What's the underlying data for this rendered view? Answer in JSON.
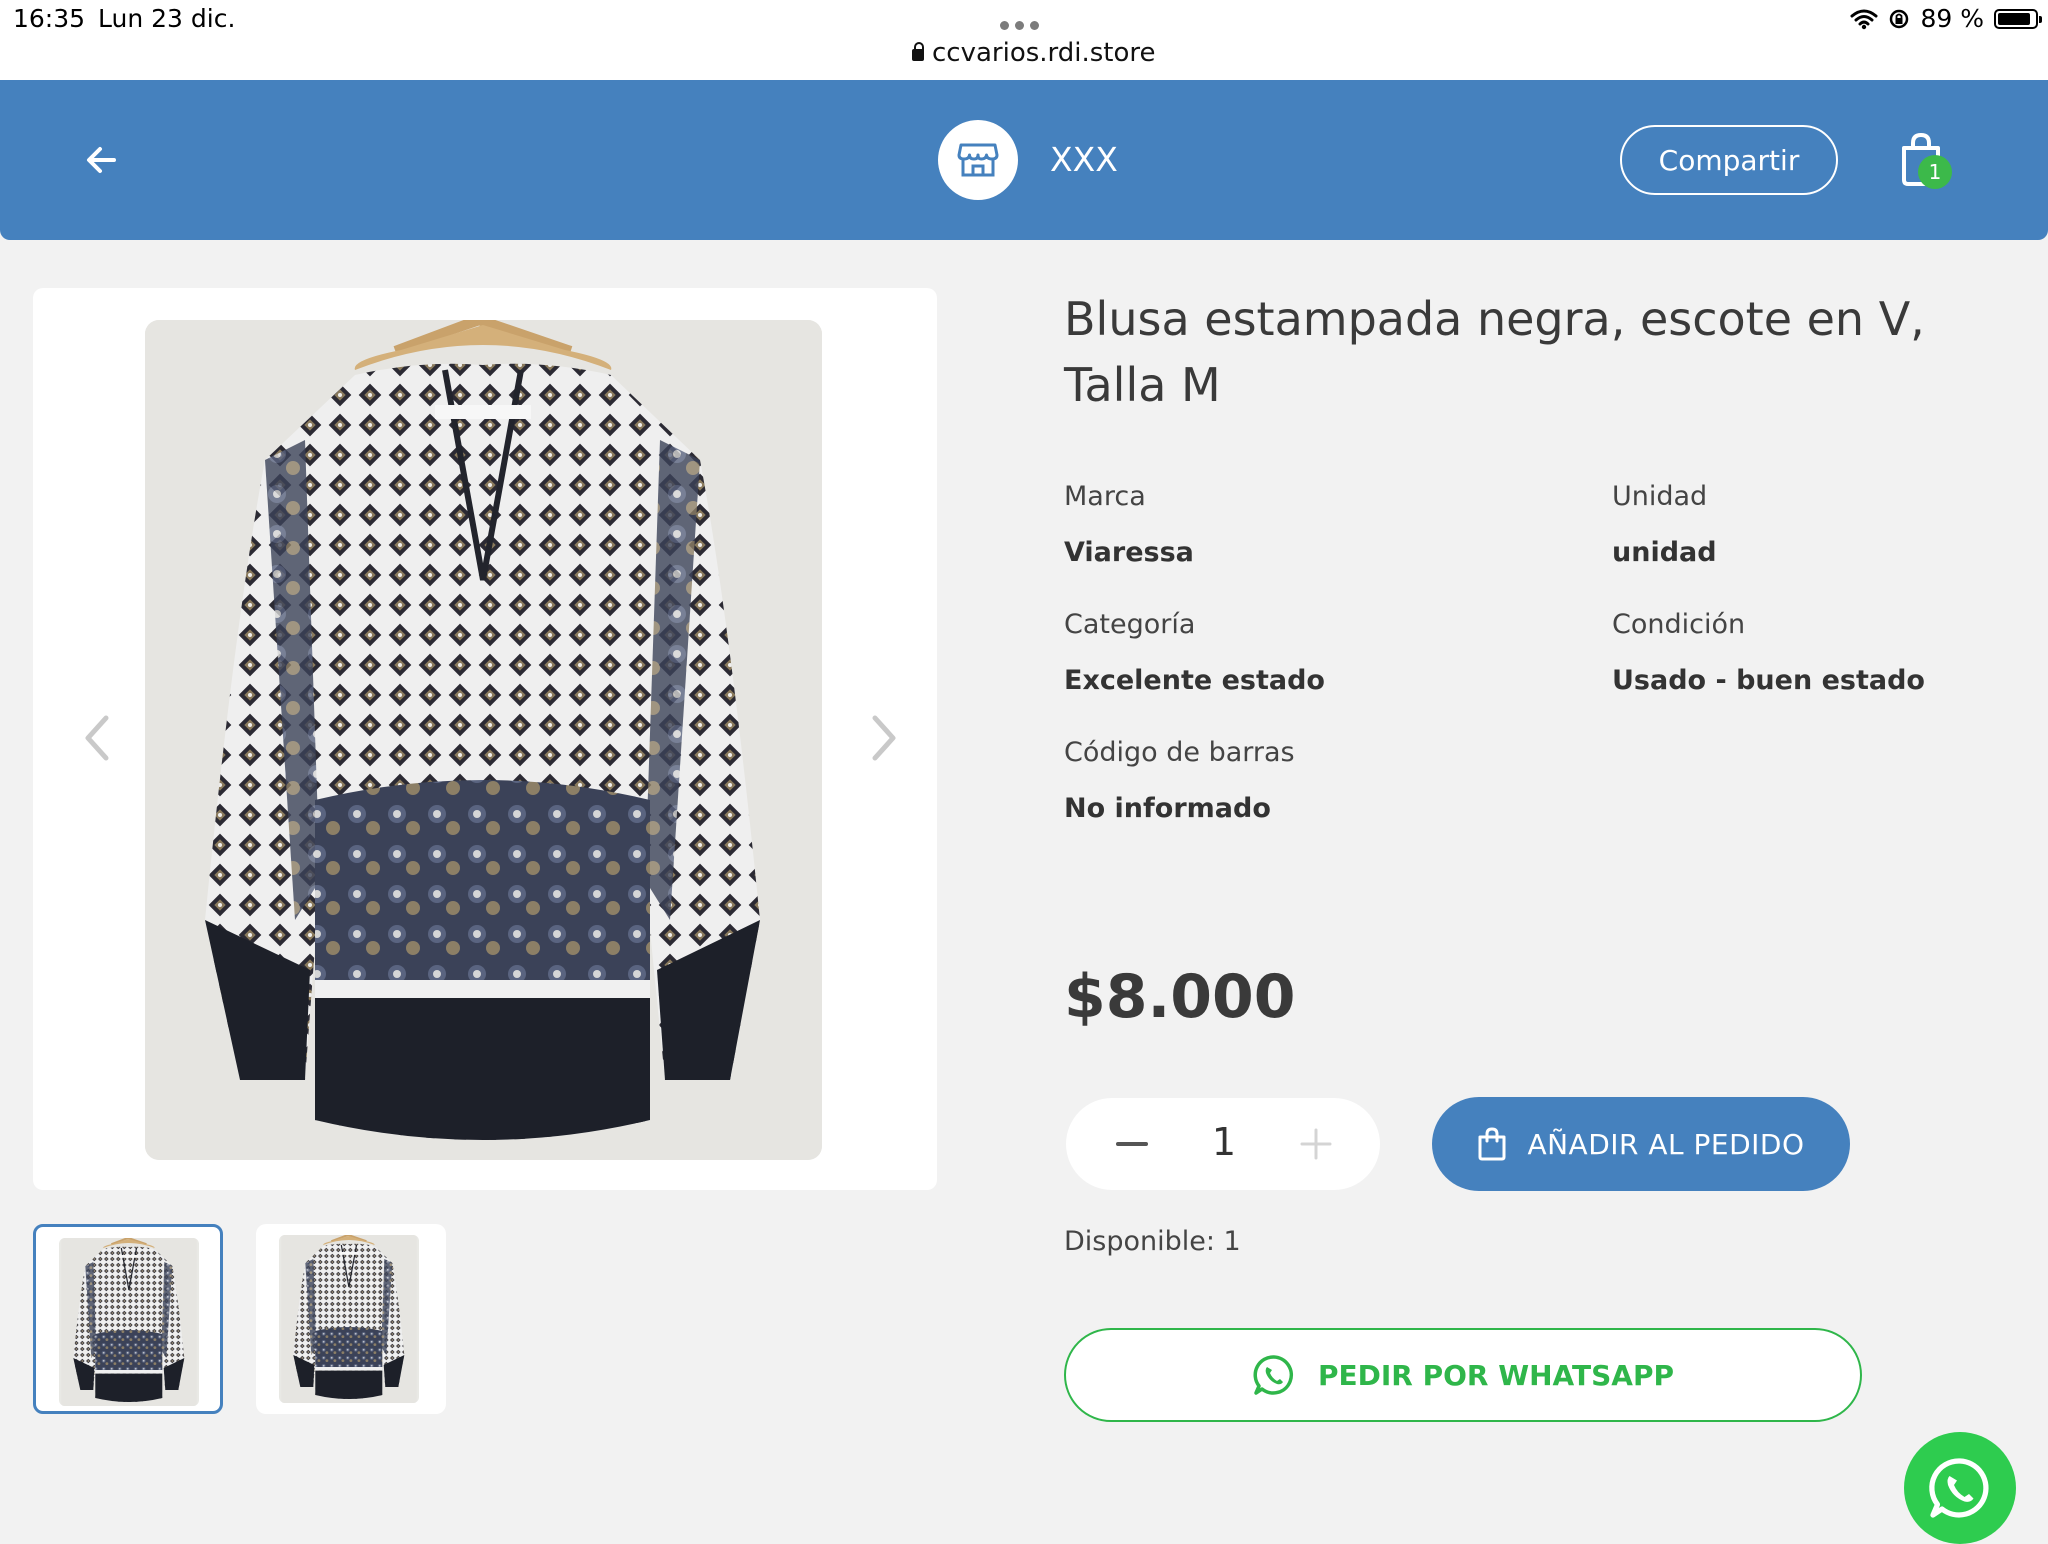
{
  "status_bar": {
    "time": "16:35",
    "date": "Lun 23 dic.",
    "url": "ccvarios.rdi.store",
    "battery": "89 %",
    "battery_level": 0.89
  },
  "header": {
    "store_name": "XXX",
    "share_label": "Compartir",
    "cart_count": "1"
  },
  "product": {
    "title": "Blusa estampada negra, escote en V, Talla M",
    "attributes": [
      {
        "label": "Marca",
        "value": "Viaressa"
      },
      {
        "label": "Unidad",
        "value": "unidad"
      },
      {
        "label": "Categoría",
        "value": "Excelente estado"
      },
      {
        "label": "Condición",
        "value": "Usado - buen estado"
      },
      {
        "label": "Código de barras",
        "value": "No informado"
      }
    ],
    "price": "$8.000",
    "quantity": "1",
    "add_label": "AÑADIR AL PEDIDO",
    "availability": "Disponible: 1",
    "whatsapp_label": "PEDIR POR WHATSAPP"
  },
  "gallery": {
    "thumbnail_count": 2,
    "active_index": 0
  },
  "colors": {
    "primary": "#4581be",
    "whatsapp": "#2fb64a",
    "badge": "#3cb94a"
  }
}
